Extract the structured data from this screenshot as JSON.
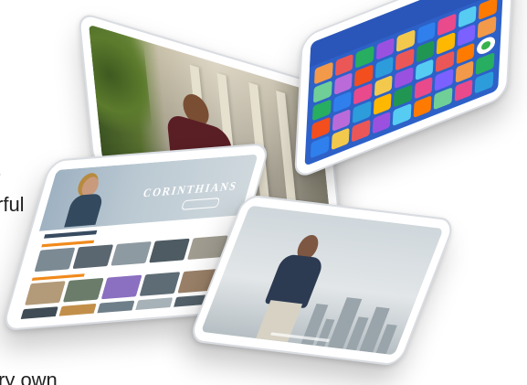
{
  "page": {
    "side_text": [
      "rful",
      "ry own"
    ],
    "side_text_period": "."
  },
  "tablets": {
    "video_top_left": {
      "content": "video-player"
    },
    "app_grid": {
      "tile_colors": [
        "#f2994a",
        "#eb5757",
        "#27ae60",
        "#9b51e0",
        "#f2c94c",
        "#2f80ed",
        "#e84a8b",
        "#56ccf2",
        "#ff7a00",
        "#6fcf97",
        "#bb6bd9",
        "#f24e1e",
        "#2d9cdb",
        "#eb5757",
        "#219653",
        "#ffb800",
        "#7b61ff",
        "#f2994a",
        "#27ae60",
        "#2f80ed",
        "#e84a8b",
        "#f2c94c",
        "#9b51e0",
        "#56ccf2",
        "#eb5757",
        "#ff7a00",
        "#6fcf97",
        "#f24e1e",
        "#bb6bd9",
        "#2d9cdb",
        "#ffb800",
        "#219653",
        "#e84a8b",
        "#7b61ff",
        "#f2994a",
        "#27ae60",
        "#2f80ed",
        "#f2c94c",
        "#eb5757",
        "#9b51e0",
        "#56ccf2",
        "#ff7a00",
        "#6fcf97",
        "#e84a8b",
        "#2d9cdb"
      ]
    },
    "browse": {
      "hero_title": "CORINTHIANS",
      "accent": "#f08a1c"
    },
    "video_bottom_right": {
      "content": "video-player"
    }
  }
}
